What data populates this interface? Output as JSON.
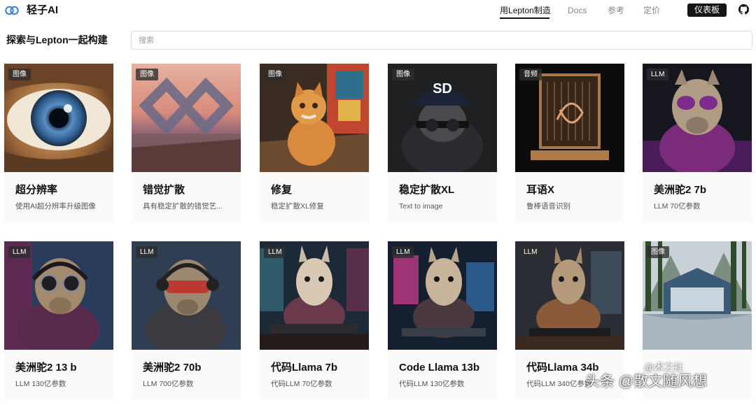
{
  "header": {
    "brand": "轻子AI",
    "nav": [
      {
        "label": "用Lepton制造",
        "active": true
      },
      {
        "label": "Docs",
        "active": false
      },
      {
        "label": "参考",
        "active": false
      },
      {
        "label": "定价",
        "active": false
      }
    ],
    "dashboard_label": "仪表板",
    "logo_icon": "lepton-logo-icon",
    "github_icon": "github-icon"
  },
  "search": {
    "title": "探索与Lepton一起构建",
    "placeholder": "搜索",
    "value": ""
  },
  "cards": [
    {
      "tag": "图像",
      "title": "超分辨率",
      "desc": "使用AI超分辨率升级图像",
      "image": "eye-closeup-image"
    },
    {
      "tag": "图像",
      "title": "错觉扩散",
      "desc": "具有稳定扩散的错觉艺...",
      "image": "illusion-sunset-image"
    },
    {
      "tag": "图像",
      "title": "修复",
      "desc": "稳定扩散XL修复",
      "image": "painter-cat-image"
    },
    {
      "tag": "图像",
      "title": "稳定扩散XL",
      "desc": "Text to image",
      "image": "sd-cap-cat-image"
    },
    {
      "tag": "音频",
      "title": "耳语X",
      "desc": "鲁棒语音识别",
      "image": "sound-frame-image"
    },
    {
      "tag": "LLM",
      "title": "美洲驼2 7b",
      "desc": "LLM 70亿参数",
      "image": "llama-goggles-image"
    },
    {
      "tag": "LLM",
      "title": "美洲驼2 13 b",
      "desc": "LLM 130亿参数",
      "image": "llama-headphones-image"
    },
    {
      "tag": "LLM",
      "title": "美洲驼2 70b",
      "desc": "LLM 700亿参数",
      "image": "llama-red-goggles-image"
    },
    {
      "tag": "LLM",
      "title": "代码Llama 7b",
      "desc": "代码LLM 70亿参数",
      "image": "llama-keyboard-image"
    },
    {
      "tag": "LLM",
      "title": "Code Llama 13b",
      "desc": "代码LLM 130亿参数",
      "image": "llama-monitor-image"
    },
    {
      "tag": "LLM",
      "title": "代码Llama 34b",
      "desc": "代码LLM 340亿参数",
      "image": "llama-desk-image"
    },
    {
      "tag": "图像",
      "title": "",
      "desc": "",
      "image": "lepton-forest-house-image"
    }
  ],
  "watermark": {
    "text": "头条 @散文随风想",
    "text2": "@术之社"
  },
  "colors": {
    "accent": "#161616",
    "muted_text": "#888888",
    "card_bg": "#fafafa"
  }
}
